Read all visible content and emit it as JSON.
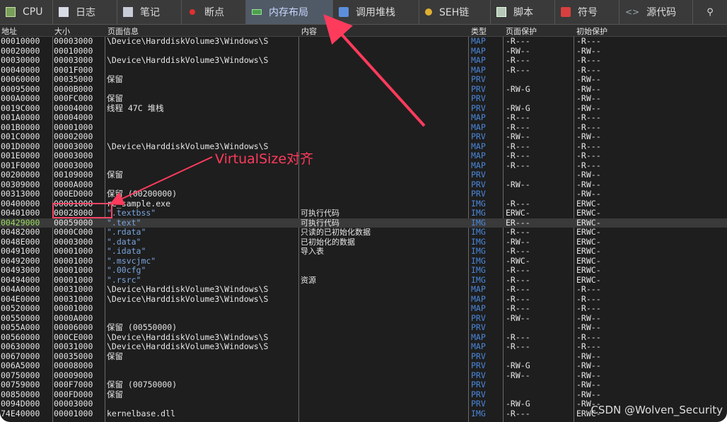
{
  "tabs": [
    {
      "label": "CPU",
      "icon": "cpu-icon",
      "active": false
    },
    {
      "label": "日志",
      "icon": "log-icon",
      "active": false
    },
    {
      "label": "笔记",
      "icon": "notes-icon",
      "active": false
    },
    {
      "label": "断点",
      "icon": "breakpoint-icon",
      "active": false
    },
    {
      "label": "内存布局",
      "icon": "memory-map-icon",
      "active": true
    },
    {
      "label": "调用堆栈",
      "icon": "call-stack-icon",
      "active": false
    },
    {
      "label": "SEH链",
      "icon": "seh-chain-icon",
      "active": false
    },
    {
      "label": "脚本",
      "icon": "script-icon",
      "active": false
    },
    {
      "label": "符号",
      "icon": "symbol-icon",
      "active": false
    },
    {
      "label": "源代码",
      "icon": "source-icon",
      "active": false
    }
  ],
  "search_icon": "search-icon",
  "columns": {
    "address": "地址",
    "size": "大小",
    "page_info": "页面信息",
    "content": "内容",
    "type": "类型",
    "protection": "页面保护",
    "initial_protection": "初始保护"
  },
  "rows": [
    {
      "address": "00010000",
      "size": "00003000",
      "info": "\\Device\\HarddiskVolume3\\Windows\\S",
      "content": "",
      "type": "MAP",
      "prot": "-R---",
      "init": "-R---"
    },
    {
      "address": "00020000",
      "size": "00010000",
      "info": "",
      "content": "",
      "type": "MAP",
      "prot": "-RW--",
      "init": "-RW--"
    },
    {
      "address": "00030000",
      "size": "00003000",
      "info": "\\Device\\HarddiskVolume3\\Windows\\S",
      "content": "",
      "type": "MAP",
      "prot": "-R---",
      "init": "-R---"
    },
    {
      "address": "00040000",
      "size": "0001F000",
      "info": "",
      "content": "",
      "type": "MAP",
      "prot": "-R---",
      "init": "-R---"
    },
    {
      "address": "00060000",
      "size": "00035000",
      "info": "保留",
      "content": "",
      "type": "PRV",
      "prot": "",
      "init": "-RW--"
    },
    {
      "address": "00095000",
      "size": "0000B000",
      "info": "",
      "content": "",
      "type": "PRV",
      "prot": "-RW-G",
      "init": "-RW--"
    },
    {
      "address": "000A0000",
      "size": "000FC000",
      "info": "保留",
      "content": "",
      "type": "PRV",
      "prot": "",
      "init": "-RW--"
    },
    {
      "address": "0019C000",
      "size": "00004000",
      "info": "线程 47C 堆栈",
      "content": "",
      "type": "PRV",
      "prot": "-RW-G",
      "init": "-RW--"
    },
    {
      "address": "001A0000",
      "size": "00004000",
      "info": "",
      "content": "",
      "type": "MAP",
      "prot": "-R---",
      "init": "-R---"
    },
    {
      "address": "001B0000",
      "size": "00001000",
      "info": "",
      "content": "",
      "type": "MAP",
      "prot": "-R---",
      "init": "-R---"
    },
    {
      "address": "001C0000",
      "size": "00002000",
      "info": "",
      "content": "",
      "type": "PRV",
      "prot": "-RW--",
      "init": "-RW--"
    },
    {
      "address": "001D0000",
      "size": "00003000",
      "info": "\\Device\\HarddiskVolume3\\Windows\\S",
      "content": "",
      "type": "MAP",
      "prot": "-R---",
      "init": "-R---"
    },
    {
      "address": "001E0000",
      "size": "00003000",
      "info": "",
      "content": "",
      "type": "MAP",
      "prot": "-R---",
      "init": "-R---"
    },
    {
      "address": "001F0000",
      "size": "00003000",
      "info": "",
      "content": "",
      "type": "MAP",
      "prot": "-R---",
      "init": "-R---"
    },
    {
      "address": "00200000",
      "size": "00109000",
      "info": "保留",
      "content": "",
      "type": "PRV",
      "prot": "",
      "init": "-RW--"
    },
    {
      "address": "00309000",
      "size": "0000A000",
      "info": "",
      "content": "",
      "type": "PRV",
      "prot": "-RW--",
      "init": "-RW--"
    },
    {
      "address": "00313000",
      "size": "000ED000",
      "info": "保留 (00200000)",
      "content": "",
      "type": "PRV",
      "prot": "",
      "init": "-RW--"
    },
    {
      "address": "00400000",
      "size": "00001000",
      "info": "re_sample.exe",
      "content": "",
      "type": "IMG",
      "prot": "-R---",
      "init": "ERWC-"
    },
    {
      "address": "00401000",
      "size": "00028000",
      "info": "\".textbss\"",
      "section": true,
      "content": "可执行代码",
      "type": "IMG",
      "prot": "ERWC-",
      "init": "ERWC-"
    },
    {
      "address": "00429000",
      "size": "00059000",
      "info": "\".text\"",
      "section": true,
      "content": "可执行代码",
      "type": "IMG",
      "prot": "ER---",
      "init": "ERWC-",
      "selected": true
    },
    {
      "address": "00482000",
      "size": "0000C000",
      "info": "\".rdata\"",
      "section": true,
      "content": "只读的已初始化数据",
      "type": "IMG",
      "prot": "-R---",
      "init": "ERWC-"
    },
    {
      "address": "0048E000",
      "size": "00003000",
      "info": "\".data\"",
      "section": true,
      "content": "已初始化的数据",
      "type": "IMG",
      "prot": "-RW--",
      "init": "ERWC-"
    },
    {
      "address": "00491000",
      "size": "00001000",
      "info": "\".idata\"",
      "section": true,
      "content": "导入表",
      "type": "IMG",
      "prot": "-R---",
      "init": "ERWC-"
    },
    {
      "address": "00492000",
      "size": "00001000",
      "info": "\".msvcjmc\"",
      "section": true,
      "content": "",
      "type": "IMG",
      "prot": "-RWC-",
      "init": "ERWC-"
    },
    {
      "address": "00493000",
      "size": "00001000",
      "info": "\".00cfg\"",
      "section": true,
      "content": "",
      "type": "IMG",
      "prot": "-R---",
      "init": "ERWC-"
    },
    {
      "address": "00494000",
      "size": "00001000",
      "info": "\".rsrc\"",
      "section": true,
      "content": "资源",
      "type": "IMG",
      "prot": "-R---",
      "init": "ERWC-"
    },
    {
      "address": "004A0000",
      "size": "00031000",
      "info": "\\Device\\HarddiskVolume3\\Windows\\S",
      "content": "",
      "type": "MAP",
      "prot": "-R---",
      "init": "-R---"
    },
    {
      "address": "004E0000",
      "size": "00031000",
      "info": "\\Device\\HarddiskVolume3\\Windows\\S",
      "content": "",
      "type": "MAP",
      "prot": "-R---",
      "init": "-R---"
    },
    {
      "address": "00520000",
      "size": "00001000",
      "info": "",
      "content": "",
      "type": "MAP",
      "prot": "-R---",
      "init": "-R---"
    },
    {
      "address": "00550000",
      "size": "0000A000",
      "info": "",
      "content": "",
      "type": "PRV",
      "prot": "-RW--",
      "init": "-RW--"
    },
    {
      "address": "0055A000",
      "size": "00006000",
      "info": "保留 (00550000)",
      "content": "",
      "type": "PRV",
      "prot": "",
      "init": "-RW--"
    },
    {
      "address": "00560000",
      "size": "000CE000",
      "info": "\\Device\\HarddiskVolume3\\Windows\\S",
      "content": "",
      "type": "MAP",
      "prot": "-R---",
      "init": "-R---"
    },
    {
      "address": "00630000",
      "size": "00031000",
      "info": "\\Device\\HarddiskVolume3\\Windows\\S",
      "content": "",
      "type": "MAP",
      "prot": "-R---",
      "init": "-R---"
    },
    {
      "address": "00670000",
      "size": "00035000",
      "info": "保留",
      "content": "",
      "type": "PRV",
      "prot": "",
      "init": "-RW--"
    },
    {
      "address": "006A5000",
      "size": "00008000",
      "info": "",
      "content": "",
      "type": "PRV",
      "prot": "-RW-G",
      "init": "-RW--"
    },
    {
      "address": "00750000",
      "size": "00009000",
      "info": "",
      "content": "",
      "type": "PRV",
      "prot": "-RW--",
      "init": "-RW--"
    },
    {
      "address": "00759000",
      "size": "000F7000",
      "info": "保留 (00750000)",
      "content": "",
      "type": "PRV",
      "prot": "",
      "init": "-RW--"
    },
    {
      "address": "00850000",
      "size": "000FD000",
      "info": "保留",
      "content": "",
      "type": "PRV",
      "prot": "",
      "init": "-RW--"
    },
    {
      "address": "0094D000",
      "size": "00003000",
      "info": "",
      "content": "",
      "type": "PRV",
      "prot": "-RW-G",
      "init": "-RW--"
    },
    {
      "address": "74E40000",
      "size": "00001000",
      "info": "kernelbase.dll",
      "content": "",
      "type": "IMG",
      "prot": "-R---",
      "init": "ERWC-"
    }
  ],
  "annotation": {
    "label": "VirtualSize对齐",
    "color": "#ff3b5c"
  },
  "watermark": "CSDN @Wolven_Security"
}
